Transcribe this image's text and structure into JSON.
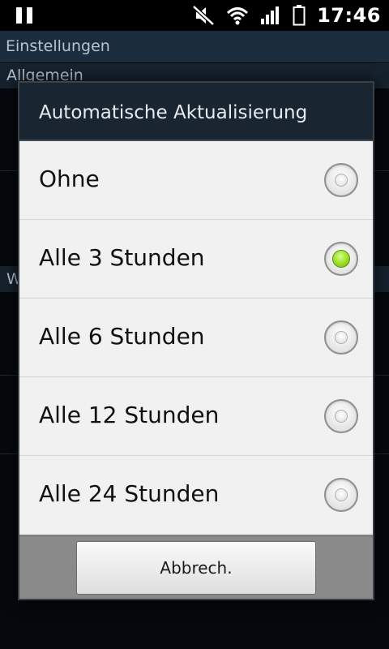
{
  "status_bar": {
    "time": "17:46",
    "icons": [
      "pause-icon",
      "mute-icon",
      "wifi-icon",
      "signal-icon",
      "battery-icon"
    ]
  },
  "background": {
    "title": "Einstellungen",
    "section_label": "Allgemein",
    "section2_label": "W"
  },
  "dialog": {
    "title": "Automatische Aktualisierung",
    "options": [
      {
        "label": "Ohne",
        "selected": false
      },
      {
        "label": "Alle 3 Stunden",
        "selected": true
      },
      {
        "label": "Alle 6 Stunden",
        "selected": false
      },
      {
        "label": "Alle 12 Stunden",
        "selected": false
      },
      {
        "label": "Alle 24 Stunden",
        "selected": false
      }
    ],
    "cancel_label": "Abbrech."
  },
  "colors": {
    "accent_green": "#9ee12b",
    "header_bg": "#1a2532",
    "list_bg": "#f1f1f1"
  }
}
